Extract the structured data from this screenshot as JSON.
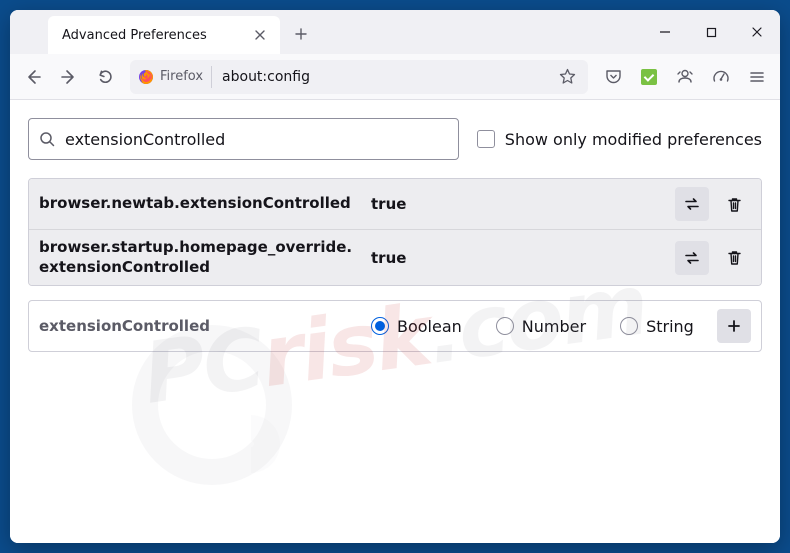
{
  "titlebar": {
    "tab_label": "Advanced Preferences"
  },
  "toolbar": {
    "identity_label": "Firefox",
    "url": "about:config"
  },
  "search": {
    "value": "extensionControlled",
    "show_modified_label": "Show only modified preferences"
  },
  "prefs": [
    {
      "name": "browser.newtab.extensionControlled",
      "value": "true"
    },
    {
      "name": "browser.startup.homepage_override.extensionControlled",
      "value": "true"
    }
  ],
  "add_row": {
    "name": "extensionControlled",
    "types": {
      "boolean": "Boolean",
      "number": "Number",
      "string": "String"
    }
  }
}
